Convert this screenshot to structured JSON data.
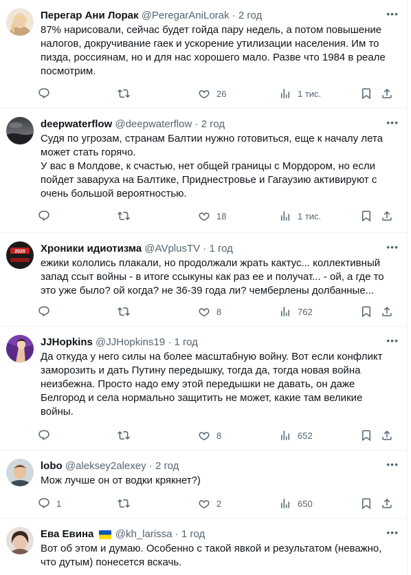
{
  "tweets": [
    {
      "name": "Перегар Ани Лорак",
      "handle": "@PeregarAniLorak",
      "dot": "·",
      "time": "2 год",
      "text": "87% нарисовали, сейчас будет гойда пару недель, а потом повышение\nналогов, докручивание гаек и ускорение утилизации населения. Им то\nпизда, россиянам, но и для нас хорошего мало. Разве что 1984 в реале\nпосмотрим.",
      "replies": "",
      "retweets": "",
      "likes": "26",
      "views": "1 тис."
    },
    {
      "name": "deepwaterflow",
      "handle": "@deepwaterflow",
      "dot": "·",
      "time": "2 год",
      "text": "Судя по угрозам, странам Балтии нужно готовиться, еще к началу лета\nможет стать горячо.\nУ вас в Молдове, к счастью, нет общей границы с Мордором, но если\nпойдет заваруха на Балтике, Приднестровье и Гагаузию активируют с\nочень большой вероятностью.",
      "replies": "",
      "retweets": "",
      "likes": "18",
      "views": "1 тис."
    },
    {
      "name": "Хроники идиотизма",
      "handle": "@AVplusTV",
      "dot": "·",
      "time": "1 год",
      "avatar_text": "2020",
      "text": "ежики кололись плакали, но продолжали жрать кактус... коллективный\nзапад ссыт войны - в итоге ссыкуны как раз ее и получат... - ой, а где то\nэто уже было? ой когда? не 36-39 года ли? чемберлены долбанные...",
      "replies": "",
      "retweets": "",
      "likes": "8",
      "views": "762"
    },
    {
      "name": "JJHopkins",
      "handle": "@JJHopkins19",
      "dot": "·",
      "time": "1 год",
      "text": "Да откуда у него силы на более масштабную войну. Вот если конфликт\nзаморозить и дать Путину передышку, тогда да, тогда новая война\nнеизбежна. Просто надо ему этой передышки не давать, он даже\nБелгород и села нормально защитить не может, какие там великие\nвойны.",
      "replies": "",
      "retweets": "",
      "likes": "8",
      "views": "652"
    },
    {
      "name": "lobo",
      "handle": "@aleksey2alexey",
      "dot": "·",
      "time": "2 год",
      "text": "Мож лучше он от водки крякнет?)",
      "replies": "1",
      "retweets": "",
      "likes": "2",
      "views": "650"
    },
    {
      "name": "Ева Евина",
      "handle": "@kh_larissa",
      "dot": "·",
      "time": "1 год",
      "text": "Вот об этом и думаю. Особенно  с такой явкой и результатом (неважно,\nчто дутым) понесется вскачь.",
      "replies": "",
      "retweets": "",
      "likes": "",
      "views": ""
    }
  ],
  "icons": {
    "more": "more-icon",
    "reply": "reply-icon",
    "retweet": "retweet-icon",
    "like": "heart-icon",
    "views": "views-icon",
    "bookmark": "bookmark-icon",
    "share": "share-icon",
    "flag": "ukraine-flag-icon"
  },
  "colors": {
    "text": "#0f1419",
    "secondary": "#536471",
    "divider": "#eff3f4",
    "flag_blue": "#0057b7",
    "flag_yellow": "#ffd700"
  }
}
